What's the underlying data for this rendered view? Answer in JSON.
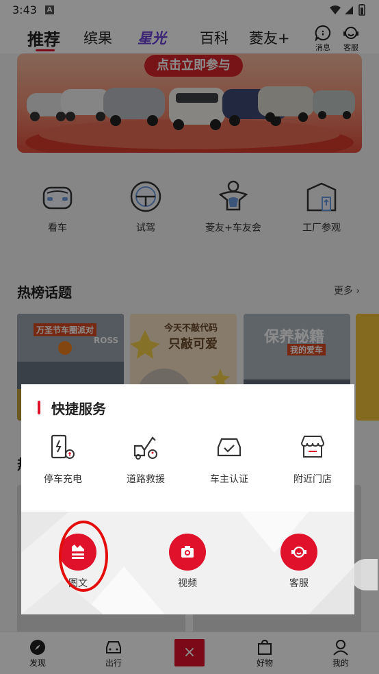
{
  "status_bar": {
    "time": "3:43",
    "notice_letter": "A"
  },
  "top_nav": {
    "tabs": [
      "推荐",
      "缤果",
      "星光",
      "百科",
      "菱友+"
    ],
    "active_tab": "推荐",
    "messages_label": "消息",
    "service_label": "客服"
  },
  "banner": {
    "cta": "点击立即参与",
    "slides": 4,
    "active_slide": 2
  },
  "quick_entries": [
    {
      "label": "看车",
      "icon": "car-front-icon"
    },
    {
      "label": "试驾",
      "icon": "steering-wheel-icon"
    },
    {
      "label": "菱友+车友会",
      "icon": "club-mascot-icon"
    },
    {
      "label": "工厂参观",
      "icon": "factory-icon"
    }
  ],
  "hot_topics": {
    "title": "热榜话题",
    "more": "更多",
    "cards": [
      {
        "caption": "万圣节车圈派对",
        "sign": "ROSS"
      },
      {
        "caption": "今天不敲代码",
        "caption2": "只敲可爱"
      },
      {
        "caption": "保养秘籍",
        "caption2": "我的爱车"
      }
    ]
  },
  "quick_services": {
    "title": "快捷服务",
    "items": [
      {
        "label": "停车充电",
        "icon": "charging-station-icon"
      },
      {
        "label": "道路救援",
        "icon": "tow-truck-icon"
      },
      {
        "label": "车主认证",
        "icon": "verified-car-icon"
      },
      {
        "label": "附近门店",
        "icon": "store-icon"
      }
    ]
  },
  "post_actions": [
    {
      "label": "图文",
      "icon": "image-text-icon"
    },
    {
      "label": "视频",
      "icon": "camera-icon"
    },
    {
      "label": "客服",
      "icon": "customer-service-icon"
    }
  ],
  "bottom_nav": {
    "items": [
      {
        "label": "发现",
        "icon": "compass-icon"
      },
      {
        "label": "出行",
        "icon": "car-icon"
      },
      {
        "label": "好物",
        "icon": "shopping-bag-icon"
      },
      {
        "label": "我的",
        "icon": "person-icon"
      }
    ],
    "close_glyph": "×"
  },
  "colors": {
    "accent": "#e0112a",
    "star_tab": "#6a3fd6",
    "annotation": "#e50c0c"
  }
}
